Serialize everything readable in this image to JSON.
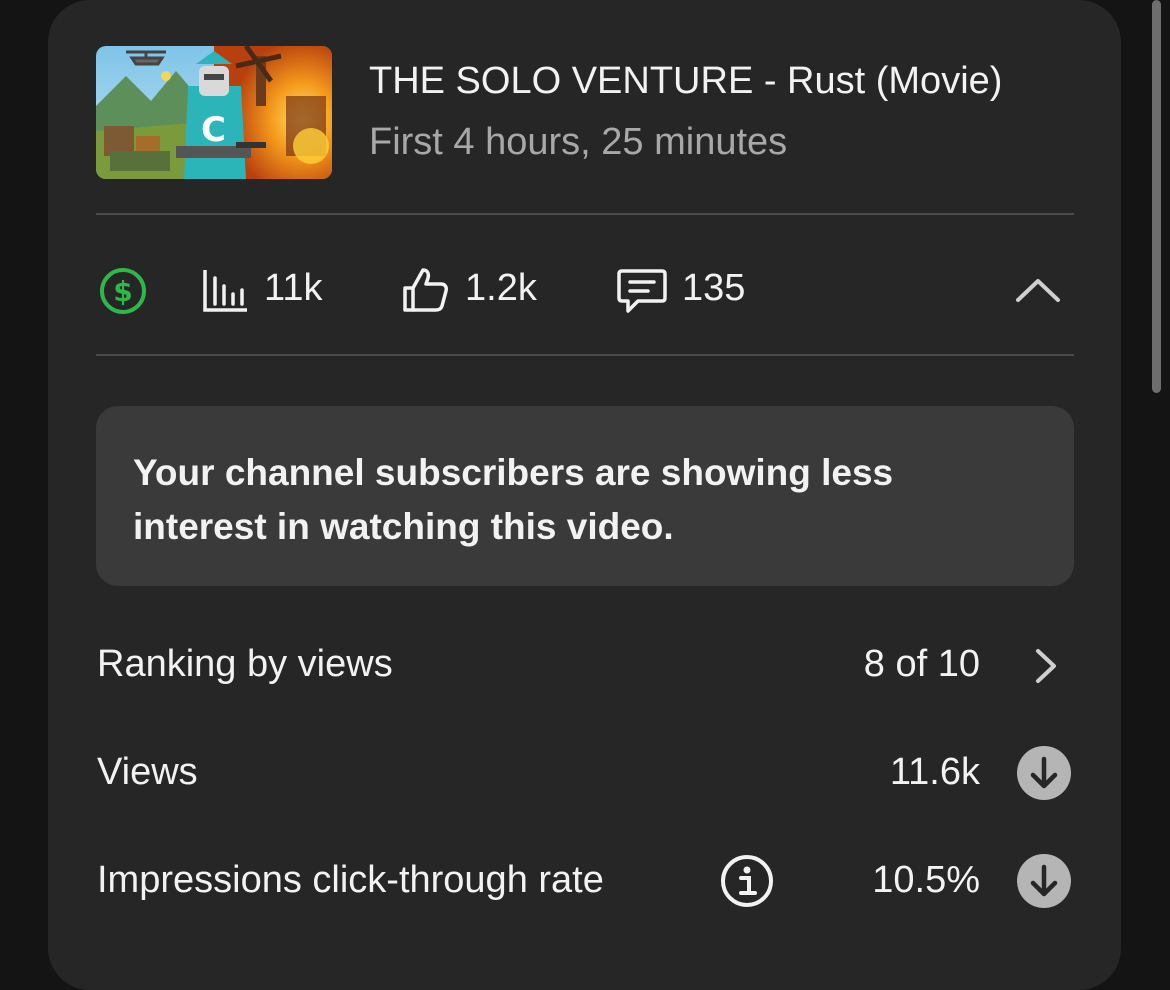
{
  "video": {
    "title": "THE SOLO VENTURE - Rust (Movie)",
    "subtitle": "First 4 hours, 25 minutes"
  },
  "stats": {
    "monetization_icon": "dollar-circle-icon",
    "views": "11k",
    "likes": "1.2k",
    "comments": "135"
  },
  "banner": {
    "message": "Your channel subscribers are showing less interest in watching this video."
  },
  "metrics": [
    {
      "label": "Ranking by views",
      "value": "8 of 10",
      "action_icon": "chevron-right-icon"
    },
    {
      "label": "Views",
      "value": "11.6k",
      "action_icon": "arrow-down-circle-icon"
    },
    {
      "label": "Impressions click-through rate",
      "value": "10.5%",
      "info_icon": "info-icon",
      "action_icon": "arrow-down-circle-icon"
    }
  ],
  "colors": {
    "background": "#141414",
    "card": "#262626",
    "banner": "#3a3a3a",
    "accent_green": "#2fb84a",
    "muted_text": "#a8a8a8"
  }
}
